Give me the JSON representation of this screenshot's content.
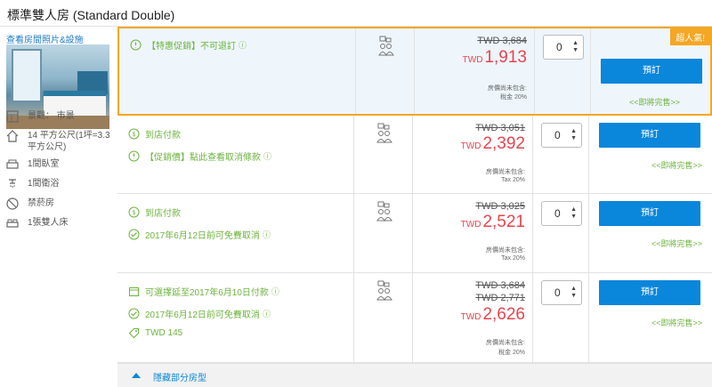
{
  "room": {
    "title": "標準雙人房 (Standard Double)",
    "photo_link": "查看房間照片&設施",
    "features": [
      {
        "icon": "view-icon",
        "text": "景觀：  市景"
      },
      {
        "icon": "house-icon",
        "text": "14 平方公尺(1坪=3.3 平方公尺)"
      },
      {
        "icon": "bed-icon",
        "text": "1間臥室"
      },
      {
        "icon": "shower-icon",
        "text": "1間衛浴"
      },
      {
        "icon": "no-smoking-icon",
        "text": "禁菸房"
      },
      {
        "icon": "double-bed-icon",
        "text": "1張雙人床"
      }
    ]
  },
  "rates": [
    {
      "policies": [
        {
          "icon": "promo-icon",
          "text": "【特惠促銷】不可退訂",
          "info": true
        }
      ],
      "occupancy_icon": "two-guests-icon",
      "original_price": "TWD 3,684",
      "original_price_2": "",
      "currency": "TWD",
      "price": "1,913",
      "tax_line1": "房價尚未包含:",
      "tax_line2": "稅金 20%",
      "quantity": "0",
      "book_label": "預訂",
      "soldout_label": "<<即將完售>>",
      "badge": "超人氣!"
    },
    {
      "policies": [
        {
          "icon": "pay-at-hotel-icon",
          "text": "到店付款",
          "info": false
        },
        {
          "icon": "promo-icon",
          "text": "【促銷價】點此查看取消條款",
          "info": true
        }
      ],
      "occupancy_icon": "two-guests-icon",
      "original_price": "TWD 3,051",
      "original_price_2": "",
      "currency": "TWD",
      "price": "2,392",
      "tax_line1": "房價尚未包含:",
      "tax_line2": "Tax 20%",
      "quantity": "0",
      "book_label": "預訂",
      "soldout_label": "<<即將完售>>",
      "badge": ""
    },
    {
      "policies": [
        {
          "icon": "pay-at-hotel-icon",
          "text": "到店付款",
          "info": false
        },
        {
          "icon": "free-cancel-icon",
          "text": "2017年6月12日前可免費取消",
          "info": true
        }
      ],
      "occupancy_icon": "two-guests-icon",
      "original_price": "TWD 3,025",
      "original_price_2": "",
      "currency": "TWD",
      "price": "2,521",
      "tax_line1": "房價尚未包含:",
      "tax_line2": "Tax 20%",
      "quantity": "0",
      "book_label": "預訂",
      "soldout_label": "<<即將完售>>",
      "badge": ""
    },
    {
      "policies": [
        {
          "icon": "pay-later-icon",
          "text": "可選擇延至2017年6月10日付款",
          "info": true
        },
        {
          "icon": "free-cancel-icon",
          "text": "2017年6月12日前可免費取消",
          "info": true
        },
        {
          "icon": "tag-icon",
          "text": "TWD 145",
          "info": false
        }
      ],
      "occupancy_icon": "two-guests-icon",
      "original_price": "TWD 3,684",
      "original_price_2": "TWD 2,771",
      "currency": "TWD",
      "price": "2,626",
      "tax_line1": "房價尚未包含:",
      "tax_line2": "稅金 20%",
      "quantity": "0",
      "book_label": "預訂",
      "soldout_label": "<<即將完售>>",
      "badge": ""
    }
  ],
  "footer": {
    "hide_label": "隱藏部分房型"
  },
  "colors": {
    "accent": "#0a86db",
    "price": "#e8444e",
    "green": "#6cb33e",
    "highlight": "#f5a623"
  }
}
